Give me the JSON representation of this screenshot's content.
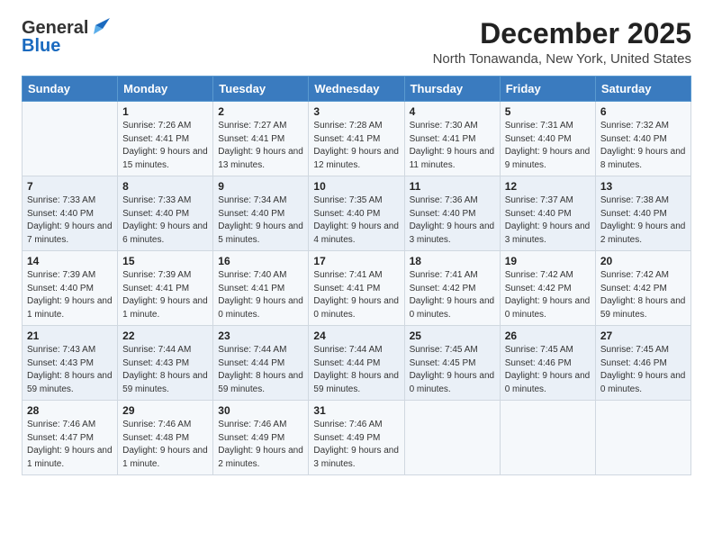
{
  "logo": {
    "general": "General",
    "blue": "Blue"
  },
  "title": "December 2025",
  "subtitle": "North Tonawanda, New York, United States",
  "days_of_week": [
    "Sunday",
    "Monday",
    "Tuesday",
    "Wednesday",
    "Thursday",
    "Friday",
    "Saturday"
  ],
  "weeks": [
    [
      {
        "day": "",
        "sunrise": "",
        "sunset": "",
        "daylight": ""
      },
      {
        "day": "1",
        "sunrise": "Sunrise: 7:26 AM",
        "sunset": "Sunset: 4:41 PM",
        "daylight": "Daylight: 9 hours and 15 minutes."
      },
      {
        "day": "2",
        "sunrise": "Sunrise: 7:27 AM",
        "sunset": "Sunset: 4:41 PM",
        "daylight": "Daylight: 9 hours and 13 minutes."
      },
      {
        "day": "3",
        "sunrise": "Sunrise: 7:28 AM",
        "sunset": "Sunset: 4:41 PM",
        "daylight": "Daylight: 9 hours and 12 minutes."
      },
      {
        "day": "4",
        "sunrise": "Sunrise: 7:30 AM",
        "sunset": "Sunset: 4:41 PM",
        "daylight": "Daylight: 9 hours and 11 minutes."
      },
      {
        "day": "5",
        "sunrise": "Sunrise: 7:31 AM",
        "sunset": "Sunset: 4:40 PM",
        "daylight": "Daylight: 9 hours and 9 minutes."
      },
      {
        "day": "6",
        "sunrise": "Sunrise: 7:32 AM",
        "sunset": "Sunset: 4:40 PM",
        "daylight": "Daylight: 9 hours and 8 minutes."
      }
    ],
    [
      {
        "day": "7",
        "sunrise": "Sunrise: 7:33 AM",
        "sunset": "Sunset: 4:40 PM",
        "daylight": "Daylight: 9 hours and 7 minutes."
      },
      {
        "day": "8",
        "sunrise": "Sunrise: 7:33 AM",
        "sunset": "Sunset: 4:40 PM",
        "daylight": "Daylight: 9 hours and 6 minutes."
      },
      {
        "day": "9",
        "sunrise": "Sunrise: 7:34 AM",
        "sunset": "Sunset: 4:40 PM",
        "daylight": "Daylight: 9 hours and 5 minutes."
      },
      {
        "day": "10",
        "sunrise": "Sunrise: 7:35 AM",
        "sunset": "Sunset: 4:40 PM",
        "daylight": "Daylight: 9 hours and 4 minutes."
      },
      {
        "day": "11",
        "sunrise": "Sunrise: 7:36 AM",
        "sunset": "Sunset: 4:40 PM",
        "daylight": "Daylight: 9 hours and 3 minutes."
      },
      {
        "day": "12",
        "sunrise": "Sunrise: 7:37 AM",
        "sunset": "Sunset: 4:40 PM",
        "daylight": "Daylight: 9 hours and 3 minutes."
      },
      {
        "day": "13",
        "sunrise": "Sunrise: 7:38 AM",
        "sunset": "Sunset: 4:40 PM",
        "daylight": "Daylight: 9 hours and 2 minutes."
      }
    ],
    [
      {
        "day": "14",
        "sunrise": "Sunrise: 7:39 AM",
        "sunset": "Sunset: 4:40 PM",
        "daylight": "Daylight: 9 hours and 1 minute."
      },
      {
        "day": "15",
        "sunrise": "Sunrise: 7:39 AM",
        "sunset": "Sunset: 4:41 PM",
        "daylight": "Daylight: 9 hours and 1 minute."
      },
      {
        "day": "16",
        "sunrise": "Sunrise: 7:40 AM",
        "sunset": "Sunset: 4:41 PM",
        "daylight": "Daylight: 9 hours and 0 minutes."
      },
      {
        "day": "17",
        "sunrise": "Sunrise: 7:41 AM",
        "sunset": "Sunset: 4:41 PM",
        "daylight": "Daylight: 9 hours and 0 minutes."
      },
      {
        "day": "18",
        "sunrise": "Sunrise: 7:41 AM",
        "sunset": "Sunset: 4:42 PM",
        "daylight": "Daylight: 9 hours and 0 minutes."
      },
      {
        "day": "19",
        "sunrise": "Sunrise: 7:42 AM",
        "sunset": "Sunset: 4:42 PM",
        "daylight": "Daylight: 9 hours and 0 minutes."
      },
      {
        "day": "20",
        "sunrise": "Sunrise: 7:42 AM",
        "sunset": "Sunset: 4:42 PM",
        "daylight": "Daylight: 8 hours and 59 minutes."
      }
    ],
    [
      {
        "day": "21",
        "sunrise": "Sunrise: 7:43 AM",
        "sunset": "Sunset: 4:43 PM",
        "daylight": "Daylight: 8 hours and 59 minutes."
      },
      {
        "day": "22",
        "sunrise": "Sunrise: 7:44 AM",
        "sunset": "Sunset: 4:43 PM",
        "daylight": "Daylight: 8 hours and 59 minutes."
      },
      {
        "day": "23",
        "sunrise": "Sunrise: 7:44 AM",
        "sunset": "Sunset: 4:44 PM",
        "daylight": "Daylight: 8 hours and 59 minutes."
      },
      {
        "day": "24",
        "sunrise": "Sunrise: 7:44 AM",
        "sunset": "Sunset: 4:44 PM",
        "daylight": "Daylight: 8 hours and 59 minutes."
      },
      {
        "day": "25",
        "sunrise": "Sunrise: 7:45 AM",
        "sunset": "Sunset: 4:45 PM",
        "daylight": "Daylight: 9 hours and 0 minutes."
      },
      {
        "day": "26",
        "sunrise": "Sunrise: 7:45 AM",
        "sunset": "Sunset: 4:46 PM",
        "daylight": "Daylight: 9 hours and 0 minutes."
      },
      {
        "day": "27",
        "sunrise": "Sunrise: 7:45 AM",
        "sunset": "Sunset: 4:46 PM",
        "daylight": "Daylight: 9 hours and 0 minutes."
      }
    ],
    [
      {
        "day": "28",
        "sunrise": "Sunrise: 7:46 AM",
        "sunset": "Sunset: 4:47 PM",
        "daylight": "Daylight: 9 hours and 1 minute."
      },
      {
        "day": "29",
        "sunrise": "Sunrise: 7:46 AM",
        "sunset": "Sunset: 4:48 PM",
        "daylight": "Daylight: 9 hours and 1 minute."
      },
      {
        "day": "30",
        "sunrise": "Sunrise: 7:46 AM",
        "sunset": "Sunset: 4:49 PM",
        "daylight": "Daylight: 9 hours and 2 minutes."
      },
      {
        "day": "31",
        "sunrise": "Sunrise: 7:46 AM",
        "sunset": "Sunset: 4:49 PM",
        "daylight": "Daylight: 9 hours and 3 minutes."
      },
      {
        "day": "",
        "sunrise": "",
        "sunset": "",
        "daylight": ""
      },
      {
        "day": "",
        "sunrise": "",
        "sunset": "",
        "daylight": ""
      },
      {
        "day": "",
        "sunrise": "",
        "sunset": "",
        "daylight": ""
      }
    ]
  ]
}
